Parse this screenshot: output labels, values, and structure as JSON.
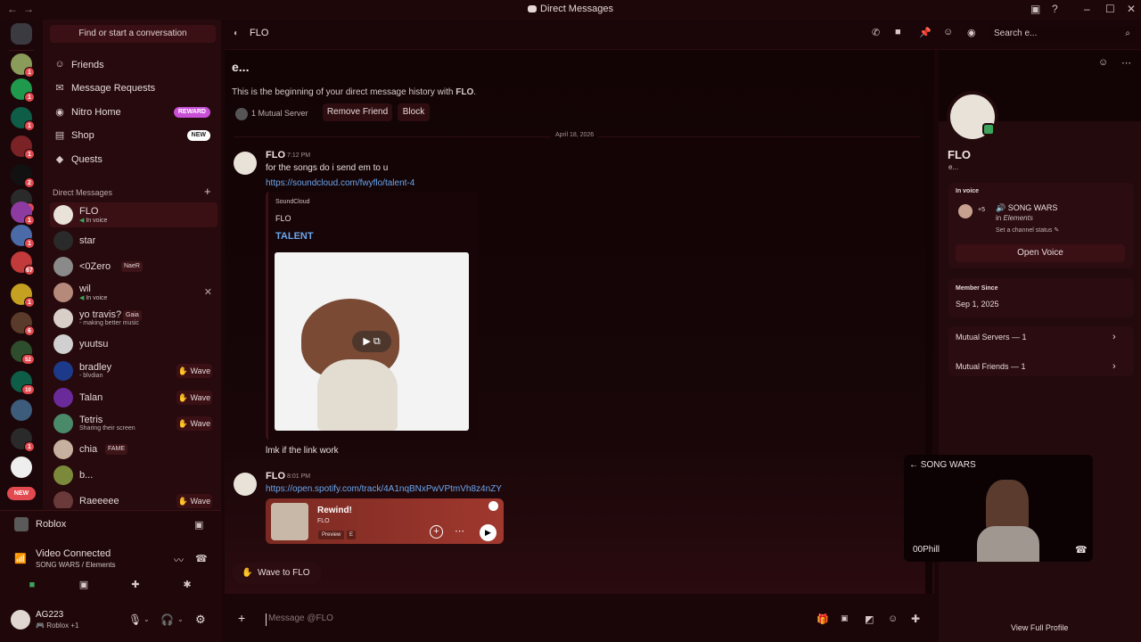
{
  "window": {
    "title": "Direct Messages",
    "back_icon": "arrow-left-icon",
    "forward_icon": "arrow-right-icon"
  },
  "rail": {
    "badges": [
      "1",
      "1",
      "1",
      "1",
      "2",
      "1",
      "1",
      "1",
      "67",
      "1",
      "6",
      "1",
      "52",
      "10",
      "1",
      "1"
    ],
    "new_label": "NEW"
  },
  "sidebar": {
    "find_placeholder": "Find or start a conversation",
    "nav": [
      {
        "label": "Friends",
        "icon": "friends-icon"
      },
      {
        "label": "Message Requests",
        "icon": "envelope-icon"
      },
      {
        "label": "Nitro Home",
        "icon": "nitro-icon",
        "pill": "REWARD"
      },
      {
        "label": "Shop",
        "icon": "shop-icon",
        "pill": "NEW"
      },
      {
        "label": "Quests",
        "icon": "quests-icon"
      }
    ],
    "dm_header": "Direct Messages",
    "dms": [
      {
        "name": "FLO",
        "sub": "In voice"
      },
      {
        "name": "star"
      },
      {
        "name": "<0Zero",
        "tag": "NaeR"
      },
      {
        "name": "wil",
        "sub": "In voice"
      },
      {
        "name": "yo travis?",
        "tag": "Gaia",
        "sub": "- making better music"
      },
      {
        "name": "yuutsu"
      },
      {
        "name": "bradley",
        "sub": "- blvdian",
        "wave": "Wave"
      },
      {
        "name": "Talan",
        "wave": "Wave"
      },
      {
        "name": "Tetris",
        "sub": "Sharing their screen",
        "wave": "Wave"
      },
      {
        "name": "chia",
        "tag": "FAME"
      },
      {
        "name": "b..."
      },
      {
        "name": "Raeeeee",
        "wave": "Wave"
      }
    ]
  },
  "voice_panel": {
    "activity": "Roblox",
    "status": "Video Connected",
    "channel": "SONG WARS / Elements",
    "user_name": "AG223",
    "user_status": "Roblox +1"
  },
  "chat_header": {
    "name": "FLO",
    "search_placeholder": "Search e..."
  },
  "chat": {
    "intro_title": "e...",
    "intro_text_prefix": "This is the beginning of your direct message history with ",
    "intro_name": "FLO",
    "intro_suffix": ".",
    "mutual": "1 Mutual Server",
    "remove_friend": "Remove Friend",
    "block": "Block",
    "date_divider": "April 18, 2026",
    "messages": [
      {
        "author": "FLO",
        "time": "7:12 PM",
        "text": "for the songs do i send em to u",
        "link": "https://soundcloud.com/fwyflo/talent-4",
        "embed": {
          "provider": "SoundCloud",
          "author": "FLO",
          "title": "TALENT"
        },
        "after": "lmk if the link work"
      },
      {
        "author": "FLO",
        "time": "8:01 PM",
        "link": "https://open.spotify.com/track/4A1nqBNxPwVPtmVh8z4nZY",
        "spotify": {
          "title": "Rewind!",
          "artist": "FLO",
          "preview": "Preview",
          "explicit": "E"
        }
      }
    ],
    "wave_button": "Wave to FLO",
    "message_placeholder": "Message @FLO"
  },
  "profile": {
    "name": "FLO",
    "sub": "e...",
    "in_voice_label": "In voice",
    "voice_channel": "SONG WARS",
    "voice_server_prefix": "in",
    "voice_server": "Elements",
    "voice_extra": "+5",
    "channel_status_hint": "Set a channel status",
    "open_voice": "Open Voice",
    "member_since_label": "Member Since",
    "member_since": "Sep 1, 2025",
    "mutual_servers": "Mutual Servers — 1",
    "mutual_friends": "Mutual Friends — 1",
    "view_full": "View Full Profile"
  },
  "call_window": {
    "channel": "SONG WARS",
    "participant": "00Phill"
  },
  "colors": {
    "accent_red": "#e24a4f",
    "link": "#6aa6ee",
    "online": "#3ba55d",
    "reward_pill": "#c94fd6"
  }
}
